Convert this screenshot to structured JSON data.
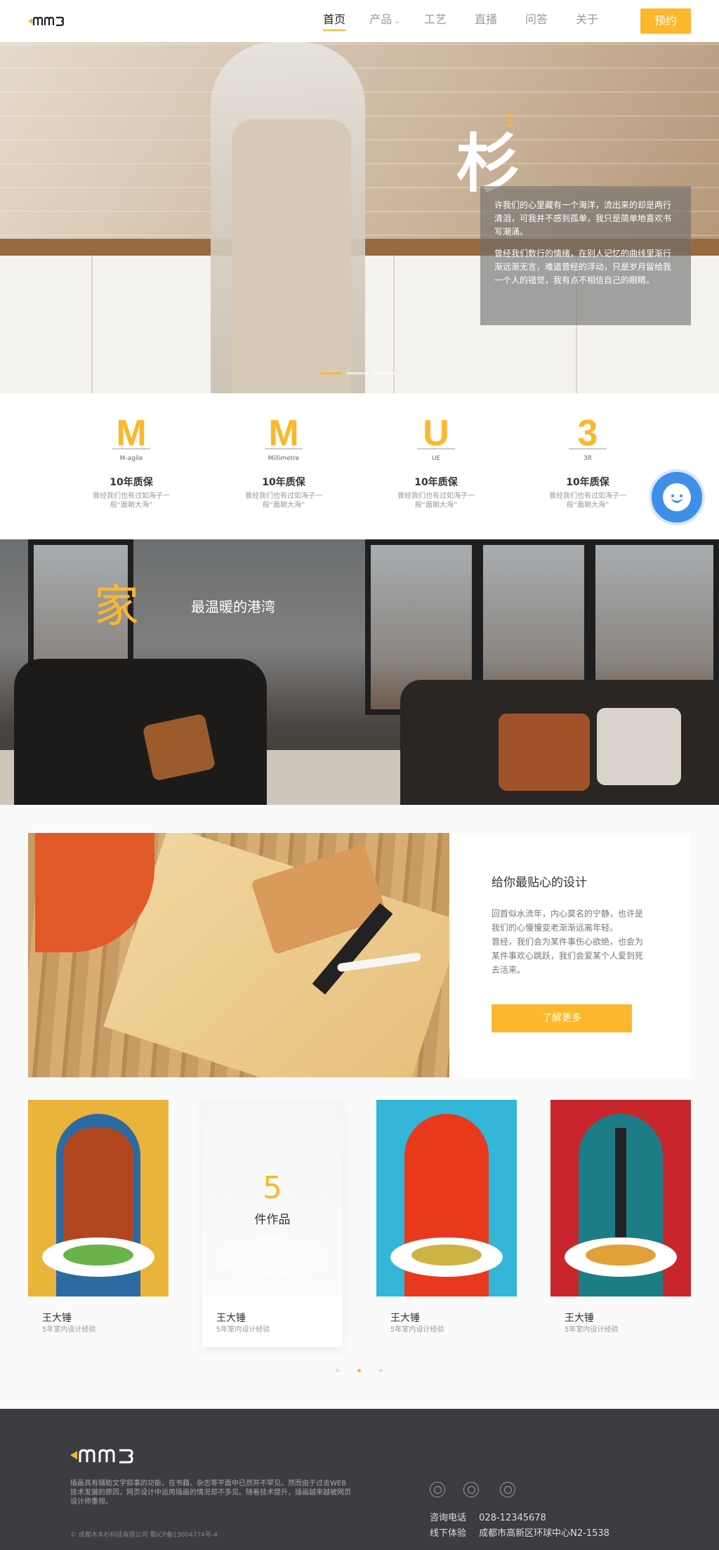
{
  "header": {
    "nav": [
      {
        "label": "首页",
        "active": true
      },
      {
        "label": "产品",
        "has_dropdown": true
      },
      {
        "label": "工艺"
      },
      {
        "label": "直播"
      },
      {
        "label": "问答"
      },
      {
        "label": "关于"
      }
    ],
    "book_label": "预约",
    "dropdown_icon": "chevron-down-icon"
  },
  "hero": {
    "title": "杉",
    "title_sup": "3",
    "paragraph1": "许我们的心里藏有一个海洋，流出来的却是两行清泪，可我并不感到孤单，我只是简单地喜欢书写潮涌。",
    "paragraph2": "曾经我们数行的情绪，在别人记忆的曲线里渐行渐远渐无言，难道曾经的浮动，只是岁月留给我一个人的错觉，我有点不相信自己的眼睛。",
    "slides": 3,
    "active_slide": 0
  },
  "features": [
    {
      "icon": "M",
      "sub": "M-agile",
      "title": "10年质保",
      "desc": "曾经我们也有过如海子一般“面朝大海”"
    },
    {
      "icon": "M",
      "sub": "Millimetre",
      "title": "10年质保",
      "desc": "曾经我们也有过如海子一般“面朝大海”"
    },
    {
      "icon": "U",
      "sub": "UE",
      "title": "10年质保",
      "desc": "曾经我们也有过如海子一般“面朝大海”"
    },
    {
      "icon": "3",
      "sub": "3R",
      "title": "10年质保",
      "desc": "曾经我们也有过如海子一般“面朝大海”"
    }
  ],
  "home_banner": {
    "big": "家",
    "sub": "最温暖的港湾"
  },
  "design": {
    "title": "给你最贴心的设计",
    "text1": "回首似水流年，内心莫名的宁静，也许是我们的心慢慢变老渐渐远离年轻。",
    "text2": "曾经，我们会为某件事伤心欲绝，也会为某件事欢心跳跃，我们会爱某个人爱到死去活来。",
    "button": "了解更多"
  },
  "designers": [
    {
      "name": "王大锤",
      "exp": "5年室内设计经验"
    },
    {
      "name": "王大锤",
      "exp": "5年室内设计经验",
      "works_count": "5",
      "works_label": "件作品"
    },
    {
      "name": "王大锤",
      "exp": "5年室内设计经验"
    },
    {
      "name": "王大锤",
      "exp": "5年室内设计经验"
    }
  ],
  "slider": {
    "pages": 3,
    "active": 1
  },
  "footer": {
    "desc": "插画具有辅助文字叙事的功能，在书籍、杂志等平面中已然并不罕见。然而由于过去WEB技术发展的原因，网页设计中运用插画的情况却不多见。随着技术提升，插画越来越被网页设计师重视。",
    "copyright": "© 成都木木杉科技有限公司 蜀ICP备13004774号-4",
    "phone_label": "咨询电话",
    "phone": "028-12345678",
    "offline_label": "线下体验",
    "address": "成都市高新区环球中心N2-1538",
    "social_icons": [
      "wechat-icon",
      "qq-icon",
      "weibo-icon"
    ]
  },
  "colors": {
    "accent": "#fdb72c",
    "footer_bg": "#3c3d41",
    "chat": "#3f8ee8"
  }
}
